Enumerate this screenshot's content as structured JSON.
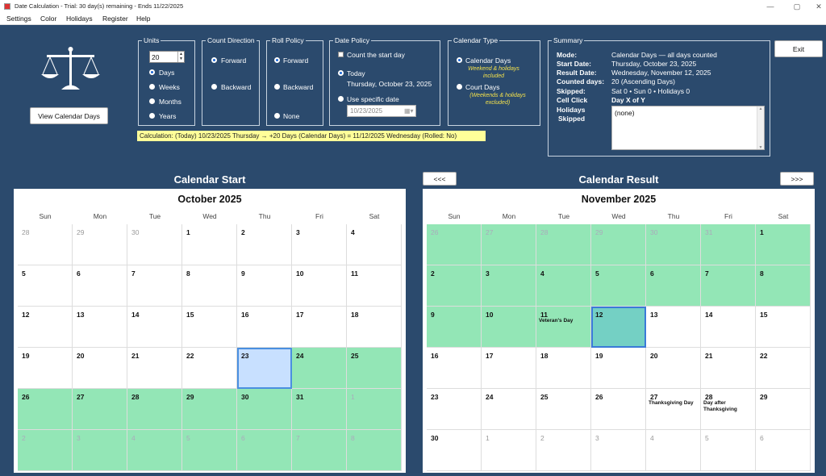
{
  "window": {
    "title": "Date Calculation - Trial: 30 day(s) remaining - Ends 11/22/2025",
    "min": "—",
    "max": "▢",
    "close": "✕"
  },
  "menu": [
    "Settings",
    "Color",
    "Holidays",
    "Register",
    "Help"
  ],
  "units": {
    "title": "Units",
    "value": "20",
    "options": [
      "Days",
      "Weeks",
      "Months",
      "Years"
    ],
    "selected": 0
  },
  "direction": {
    "title": "Count Direction",
    "options": [
      "Forward",
      "Backward"
    ],
    "selected": 0
  },
  "roll": {
    "title": "Roll Policy",
    "options": [
      "Forward",
      "Backward",
      "None"
    ],
    "selected": 0
  },
  "date_policy": {
    "title": "Date Policy",
    "count_start": "Count the start day",
    "today": "Today",
    "today_date": "Thursday, October 23, 2025",
    "specific": "Use specific date",
    "specific_value": "10/23/2025"
  },
  "calendar_type": {
    "title": "Calendar Type",
    "opt1": "Calendar Days",
    "opt1_note": "Weekend & holidays included",
    "opt2": "Court Days",
    "opt2_note": "(Weekends & holidays excluded)"
  },
  "summary": {
    "title": "Summary",
    "rows": [
      {
        "label": "Mode:",
        "value": "Calendar Days — all days counted"
      },
      {
        "label": "Start Date:",
        "value": "Thursday, October 23, 2025"
      },
      {
        "label": "Result Date:",
        "value": "Wednesday, November 12, 2025"
      },
      {
        "label": "Counted days:",
        "value": "20 (Ascending Days)"
      },
      {
        "label": "Skipped:",
        "value": "Sat 0 • Sun 0 • Holidays 0"
      },
      {
        "label": "Cell Click",
        "value": "Day X of Y"
      }
    ],
    "holidays_label_1": "Holidays",
    "holidays_label_2": "Skipped",
    "holidays_value": "(none)"
  },
  "buttons": {
    "exit": "Exit",
    "view_calendar": "View Calendar Days",
    "prev": "<<<",
    "next": ">>>"
  },
  "calculation": "Calculation:   (Today) 10/23/2025 Thursday → +20 Days (Calendar Days) = 11/12/2025 Wednesday (Rolled: No)",
  "calendar_start": {
    "section_title": "Calendar Start",
    "month": "October 2025",
    "dow": [
      "Sun",
      "Mon",
      "Tue",
      "Wed",
      "Thu",
      "Fri",
      "Sat"
    ],
    "weeks": [
      [
        {
          "d": "28",
          "o": 1
        },
        {
          "d": "29",
          "o": 1
        },
        {
          "d": "30",
          "o": 1
        },
        {
          "d": "1"
        },
        {
          "d": "2"
        },
        {
          "d": "3"
        },
        {
          "d": "4"
        }
      ],
      [
        {
          "d": "5"
        },
        {
          "d": "6"
        },
        {
          "d": "7"
        },
        {
          "d": "8"
        },
        {
          "d": "9"
        },
        {
          "d": "10"
        },
        {
          "d": "11"
        }
      ],
      [
        {
          "d": "12"
        },
        {
          "d": "13"
        },
        {
          "d": "14"
        },
        {
          "d": "15"
        },
        {
          "d": "16"
        },
        {
          "d": "17"
        },
        {
          "d": "18"
        }
      ],
      [
        {
          "d": "19"
        },
        {
          "d": "20"
        },
        {
          "d": "21"
        },
        {
          "d": "22"
        },
        {
          "d": "23",
          "s": "start"
        },
        {
          "d": "24",
          "g": 1
        },
        {
          "d": "25",
          "g": 1
        }
      ],
      [
        {
          "d": "26",
          "g": 1
        },
        {
          "d": "27",
          "g": 1
        },
        {
          "d": "28",
          "g": 1
        },
        {
          "d": "29",
          "g": 1
        },
        {
          "d": "30",
          "g": 1
        },
        {
          "d": "31",
          "g": 1
        },
        {
          "d": "1",
          "o": 1,
          "g": 1
        }
      ],
      [
        {
          "d": "2",
          "o": 1,
          "g": 1
        },
        {
          "d": "3",
          "o": 1,
          "g": 1
        },
        {
          "d": "4",
          "o": 1,
          "g": 1
        },
        {
          "d": "5",
          "o": 1,
          "g": 1
        },
        {
          "d": "6",
          "o": 1,
          "g": 1
        },
        {
          "d": "7",
          "o": 1,
          "g": 1
        },
        {
          "d": "8",
          "o": 1,
          "g": 1
        }
      ]
    ]
  },
  "calendar_result": {
    "section_title": "Calendar Result",
    "month": "November 2025",
    "dow": [
      "Sun",
      "Mon",
      "Tue",
      "Wed",
      "Thu",
      "Fri",
      "Sat"
    ],
    "weeks": [
      [
        {
          "d": "26",
          "o": 1,
          "g": 1
        },
        {
          "d": "27",
          "o": 1,
          "g": 1
        },
        {
          "d": "28",
          "o": 1,
          "g": 1
        },
        {
          "d": "29",
          "o": 1,
          "g": 1
        },
        {
          "d": "30",
          "o": 1,
          "g": 1
        },
        {
          "d": "31",
          "o": 1,
          "g": 1
        },
        {
          "d": "1",
          "g": 1
        }
      ],
      [
        {
          "d": "2",
          "g": 1
        },
        {
          "d": "3",
          "g": 1
        },
        {
          "d": "4",
          "g": 1
        },
        {
          "d": "5",
          "g": 1
        },
        {
          "d": "6",
          "g": 1
        },
        {
          "d": "7",
          "g": 1
        },
        {
          "d": "8",
          "g": 1
        }
      ],
      [
        {
          "d": "9",
          "g": 1
        },
        {
          "d": "10",
          "g": 1
        },
        {
          "d": "11",
          "g": 1,
          "h": "Veteran's Day"
        },
        {
          "d": "12",
          "s": "result"
        },
        {
          "d": "13"
        },
        {
          "d": "14"
        },
        {
          "d": "15"
        }
      ],
      [
        {
          "d": "16"
        },
        {
          "d": "17"
        },
        {
          "d": "18"
        },
        {
          "d": "19"
        },
        {
          "d": "20"
        },
        {
          "d": "21"
        },
        {
          "d": "22"
        }
      ],
      [
        {
          "d": "23"
        },
        {
          "d": "24"
        },
        {
          "d": "25"
        },
        {
          "d": "26"
        },
        {
          "d": "27",
          "h": "Thanksgiving Day"
        },
        {
          "d": "28",
          "h": "Day after Thanksgiving"
        },
        {
          "d": "29"
        }
      ],
      [
        {
          "d": "30"
        },
        {
          "d": "1",
          "o": 1
        },
        {
          "d": "2",
          "o": 1
        },
        {
          "d": "3",
          "o": 1
        },
        {
          "d": "4",
          "o": 1
        },
        {
          "d": "5",
          "o": 1
        },
        {
          "d": "6",
          "o": 1
        }
      ]
    ]
  },
  "colors": {
    "background": "#2b4a6d",
    "counted": "#93e6b6",
    "start": "#c8e0ff",
    "result": "#74d0c4",
    "calc_bg": "#ffff99"
  }
}
